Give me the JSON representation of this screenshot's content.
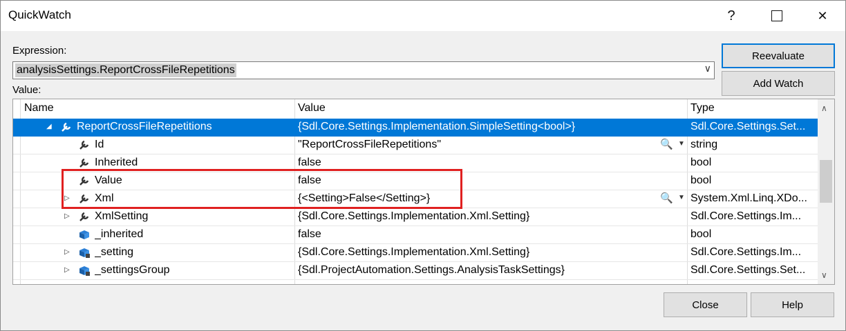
{
  "window": {
    "title": "QuickWatch"
  },
  "titlebar": {
    "help": "?",
    "close": "✕"
  },
  "expression": {
    "label": "Expression:",
    "value": "analysisSettings.ReportCrossFileRepetitions"
  },
  "value_label": "Value:",
  "buttons": {
    "reevaluate": "Reevaluate",
    "add_watch": "Add Watch",
    "close": "Close",
    "help": "Help"
  },
  "grid": {
    "headers": {
      "name": "Name",
      "value": "Value",
      "type": "Type"
    },
    "rows": [
      {
        "name": "ReportCrossFileRepetitions",
        "value": "{Sdl.Core.Settings.Implementation.SimpleSetting<bool>}",
        "type": "Sdl.Core.Settings.Set..."
      },
      {
        "name": "Id",
        "value": "\"ReportCrossFileRepetitions\"",
        "type": "string"
      },
      {
        "name": "Inherited",
        "value": "false",
        "type": "bool"
      },
      {
        "name": "Value",
        "value": "false",
        "type": "bool"
      },
      {
        "name": "Xml",
        "value": "{<Setting>False</Setting>}",
        "type": "System.Xml.Linq.XDo..."
      },
      {
        "name": "XmlSetting",
        "value": "{Sdl.Core.Settings.Implementation.Xml.Setting}",
        "type": "Sdl.Core.Settings.Im..."
      },
      {
        "name": "_inherited",
        "value": "false",
        "type": "bool"
      },
      {
        "name": "_setting",
        "value": "{Sdl.Core.Settings.Implementation.Xml.Setting}",
        "type": "Sdl.Core.Settings.Im..."
      },
      {
        "name": "_settingsGroup",
        "value": "{Sdl.ProjectAutomation.Settings.AnalysisTaskSettings}",
        "type": "Sdl.Core.Settings.Set..."
      }
    ]
  },
  "colors": {
    "selection": "#0078d7",
    "highlight": "#e02020"
  }
}
